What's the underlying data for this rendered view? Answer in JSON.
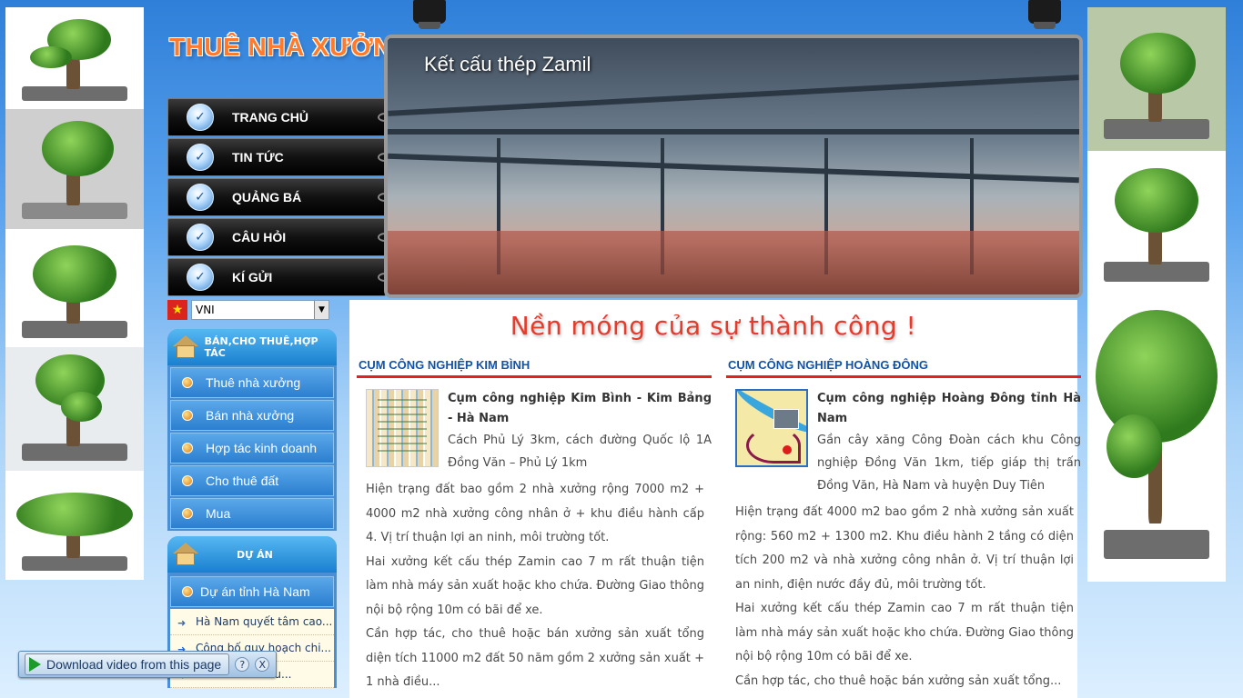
{
  "site_title": "THUÊ NHÀ XƯỞNG",
  "nav": {
    "items": [
      {
        "label": "TRANG CHỦ"
      },
      {
        "label": "TIN TỨC"
      },
      {
        "label": "QUẢNG BÁ"
      },
      {
        "label": "CÂU HỎI"
      },
      {
        "label": "KÍ GỬI"
      }
    ]
  },
  "banner": {
    "caption": "Kết cấu thép Zamil"
  },
  "language": {
    "selected": "VNI",
    "flag_symbol": "★"
  },
  "categories": {
    "title": "BÁN,CHO THUÊ,HỢP TÁC",
    "items": [
      {
        "label": "Thuê nhà xưởng"
      },
      {
        "label": "Bán nhà xưởng"
      },
      {
        "label": "Hợp tác kinh doanh"
      },
      {
        "label": "Cho thuê đất"
      },
      {
        "label": "Mua"
      }
    ]
  },
  "projects": {
    "title": "DỰ ÁN",
    "group": "Dự án tỉnh Hà Nam",
    "items": [
      {
        "label": "Hà Nam quyết tâm cao..."
      },
      {
        "label": "Công bố quy hoạch chi..."
      },
      {
        "label": "...hâu..."
      }
    ]
  },
  "slogan": "Nền móng của sự thành công !",
  "left_column": {
    "title": "CỤM CÔNG NGHIỆP KIM BÌNH",
    "headline": "Cụm công nghiệp Kim Bình - Kim Bảng - Hà Nam",
    "summary": "Cách Phủ Lý 3km, cách đường Quốc lộ 1A Đồng Văn – Phủ Lý 1km",
    "paragraphs": [
      "Hiện trạng đất bao gồm 2 nhà xưởng rộng 7000 m2 + 4000 m2 nhà xưởng công nhân ở + khu điều hành cấp 4. Vị trí thuận lợi an ninh, môi trường tốt.",
      "Hai xưởng kết cấu thép Zamin cao 7 m rất thuận tiện làm nhà máy sản xuất hoặc kho chứa. Đường Giao thông nội bộ rộng 10m có bãi để xe.",
      "Cần hợp tác, cho thuê hoặc bán xưởng sản xuất tổng diện tích 11000 m2 đất 50 năm gồm 2 xưởng sản xuất + 1 nhà điều..."
    ]
  },
  "right_column": {
    "title": "CỤM CÔNG NGHIỆP HOÀNG ĐÔNG",
    "headline": "Cụm công nghiệp Hoàng Đông tỉnh Hà Nam",
    "summary": "Gần cây xăng Công Đoàn cách khu Công nghiệp Đồng Văn 1km, tiếp giáp thị trấn Đồng Văn, Hà Nam và huyện Duy Tiên",
    "paragraphs": [
      "Hiện trạng đất 4000 m2 bao gồm 2 nhà xưởng sản xuất rộng: 560 m2 + 1300 m2. Khu điều hành 2 tầng có diện tích 200 m2 và nhà xưởng công nhân ở. Vị trí thuận lợi an ninh, điện nước đầy đủ, môi trường tốt.",
      "Hai xưởng kết cấu thép Zamin cao 7 m rất thuận tiện làm nhà máy sản xuất hoặc kho chứa. Đường Giao thông nội bộ rộng 10m có bãi để xe.",
      "Cần hợp tác, cho thuê hoặc bán xưởng sản xuất tổng..."
    ]
  },
  "download_bar": {
    "label": "Download video from this page",
    "help": "?",
    "close": "X"
  }
}
